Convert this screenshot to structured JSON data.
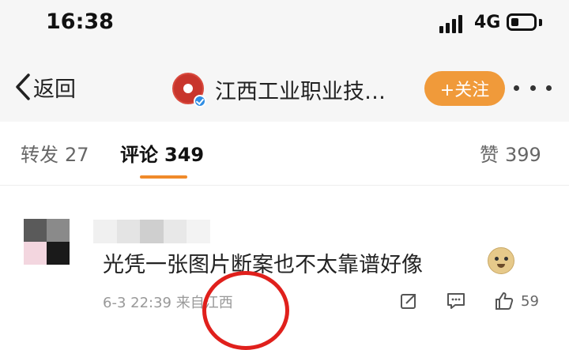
{
  "status_bar": {
    "time": "16:38",
    "network": "4G"
  },
  "nav": {
    "back_label": "返回",
    "account_name": "江西工业职业技…",
    "follow_label": "+关注"
  },
  "tabs": [
    {
      "label": "转发",
      "count": "27"
    },
    {
      "label": "评论",
      "count": "349"
    },
    {
      "label": "赞",
      "count": "399"
    }
  ],
  "comment": {
    "text": "光凭一张图片断案也不太靠谱好像",
    "meta": "6-3 22:39 来自江西",
    "like_count": "59"
  },
  "colors": {
    "accent": "#f08a2a",
    "follow_button": "#f09a3a",
    "annotation_red": "#e0201c"
  },
  "icons": [
    "back-chevron-icon",
    "signal-icon",
    "battery-icon",
    "more-dots-icon",
    "doge-emoji-icon",
    "share-icon",
    "comment-icon",
    "like-icon"
  ]
}
